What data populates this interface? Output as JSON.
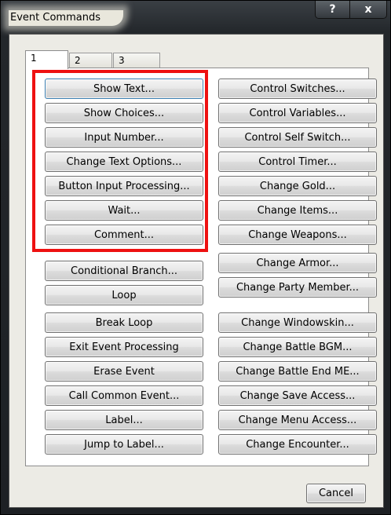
{
  "window": {
    "title": "Event Commands",
    "help_label": "?",
    "close_label": "x"
  },
  "tabs": [
    {
      "label": "1",
      "active": true
    },
    {
      "label": "2",
      "active": false
    },
    {
      "label": "3",
      "active": false
    }
  ],
  "left_buttons": [
    "Show Text...",
    "Show Choices...",
    "Input Number...",
    "Change Text Options...",
    "Button Input Processing...",
    "Wait...",
    "Comment...",
    "Conditional Branch...",
    "Loop",
    "Break Loop",
    "Exit Event Processing",
    "Erase Event",
    "Call Common Event...",
    "Label...",
    "Jump to Label..."
  ],
  "right_buttons": [
    "Control Switches...",
    "Control Variables...",
    "Control Self Switch...",
    "Control Timer...",
    "Change Gold...",
    "Change Items...",
    "Change Weapons...",
    "Change Armor...",
    "Change Party Member...",
    "Change Windowskin...",
    "Change Battle BGM...",
    "Change Battle End ME...",
    "Change Save Access...",
    "Change Menu Access...",
    "Change Encounter..."
  ],
  "footer": {
    "cancel_label": "Cancel"
  },
  "colors": {
    "highlight_box": "#ee1111",
    "window_frame": "#23272b",
    "client_bg": "#ecebe5"
  }
}
